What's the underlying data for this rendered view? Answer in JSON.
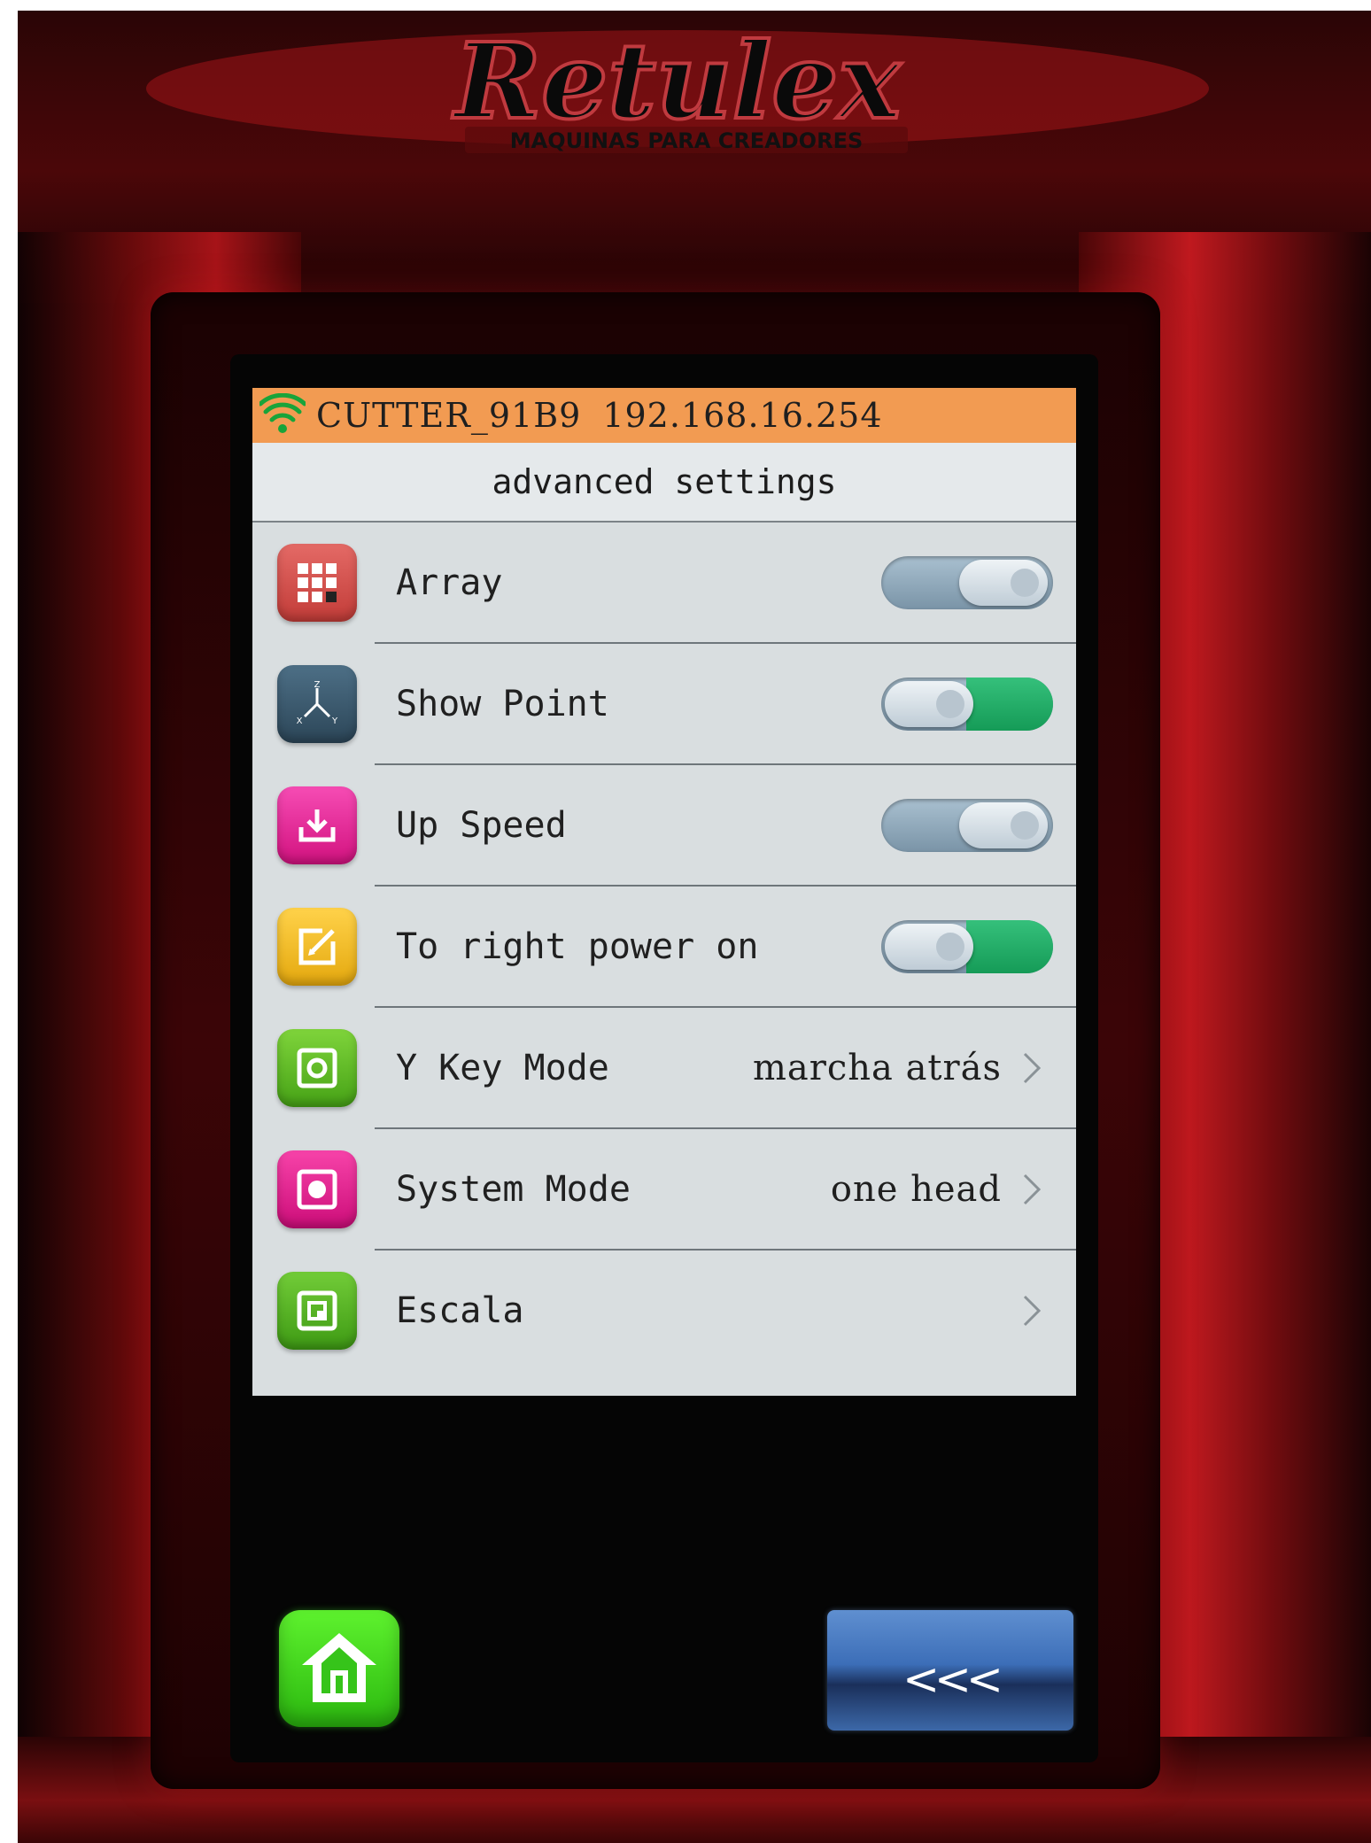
{
  "logo": {
    "brand": "Retulex",
    "tagline": "MAQUINAS PARA CREADORES"
  },
  "status_bar": {
    "device_name": "CUTTER_91B9",
    "ip_address": "192.168.16.254",
    "wifi_icon": "wifi-icon",
    "color": "#f29b52"
  },
  "page": {
    "title": "advanced settings"
  },
  "settings": [
    {
      "label": "Array",
      "icon": "grid-icon",
      "icon_color": "#d9534f",
      "type": "toggle",
      "state": "off"
    },
    {
      "label": "Show Point",
      "icon": "xyz-axis-icon",
      "icon_color": "#3f5f75",
      "type": "toggle",
      "state": "on"
    },
    {
      "label": "Up Speed",
      "icon": "download-tray-icon",
      "icon_color": "#ec1f9a",
      "type": "toggle",
      "state": "off"
    },
    {
      "label": "To right power on",
      "icon": "edit-square-icon",
      "icon_color": "#f4bf1f",
      "type": "toggle",
      "state": "on"
    },
    {
      "label": "Y Key Mode",
      "icon": "target-square-icon",
      "icon_color": "#5cba24",
      "type": "select",
      "value": "marcha atrás"
    },
    {
      "label": "System Mode",
      "icon": "record-square-icon",
      "icon_color": "#ea1c8f",
      "type": "select",
      "value": "one head"
    },
    {
      "label": "Escala",
      "icon": "nested-square-icon",
      "icon_color": "#4fb627",
      "type": "select",
      "value": ""
    }
  ],
  "toggle_colors": {
    "on": "#1fa862",
    "off": "#8ea6b8"
  },
  "nav": {
    "home_icon": "home-icon",
    "back_label": "<<<"
  }
}
